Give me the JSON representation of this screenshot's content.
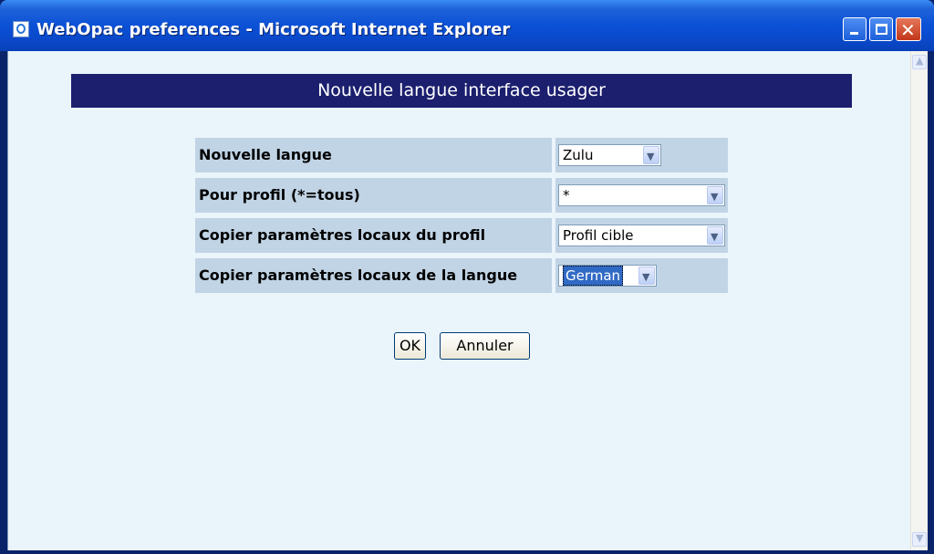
{
  "window": {
    "title": "WebOpac preferences - Microsoft Internet Explorer"
  },
  "banner": {
    "title": "Nouvelle langue interface usager"
  },
  "form": {
    "rows": [
      {
        "label": "Nouvelle langue",
        "value": "Zulu"
      },
      {
        "label": "Pour profil (*=tous)",
        "value": "*"
      },
      {
        "label": "Copier paramètres locaux du profil",
        "value": "Profil cible"
      },
      {
        "label": "Copier paramètres locaux de la langue",
        "value": "German"
      }
    ]
  },
  "buttons": {
    "ok": "OK",
    "cancel": "Annuler"
  },
  "colors": {
    "banner_bg": "#1b1f6e",
    "row_bg": "#c1d4e5",
    "page_bg": "#eaf4fb",
    "selection": "#316ac5"
  }
}
